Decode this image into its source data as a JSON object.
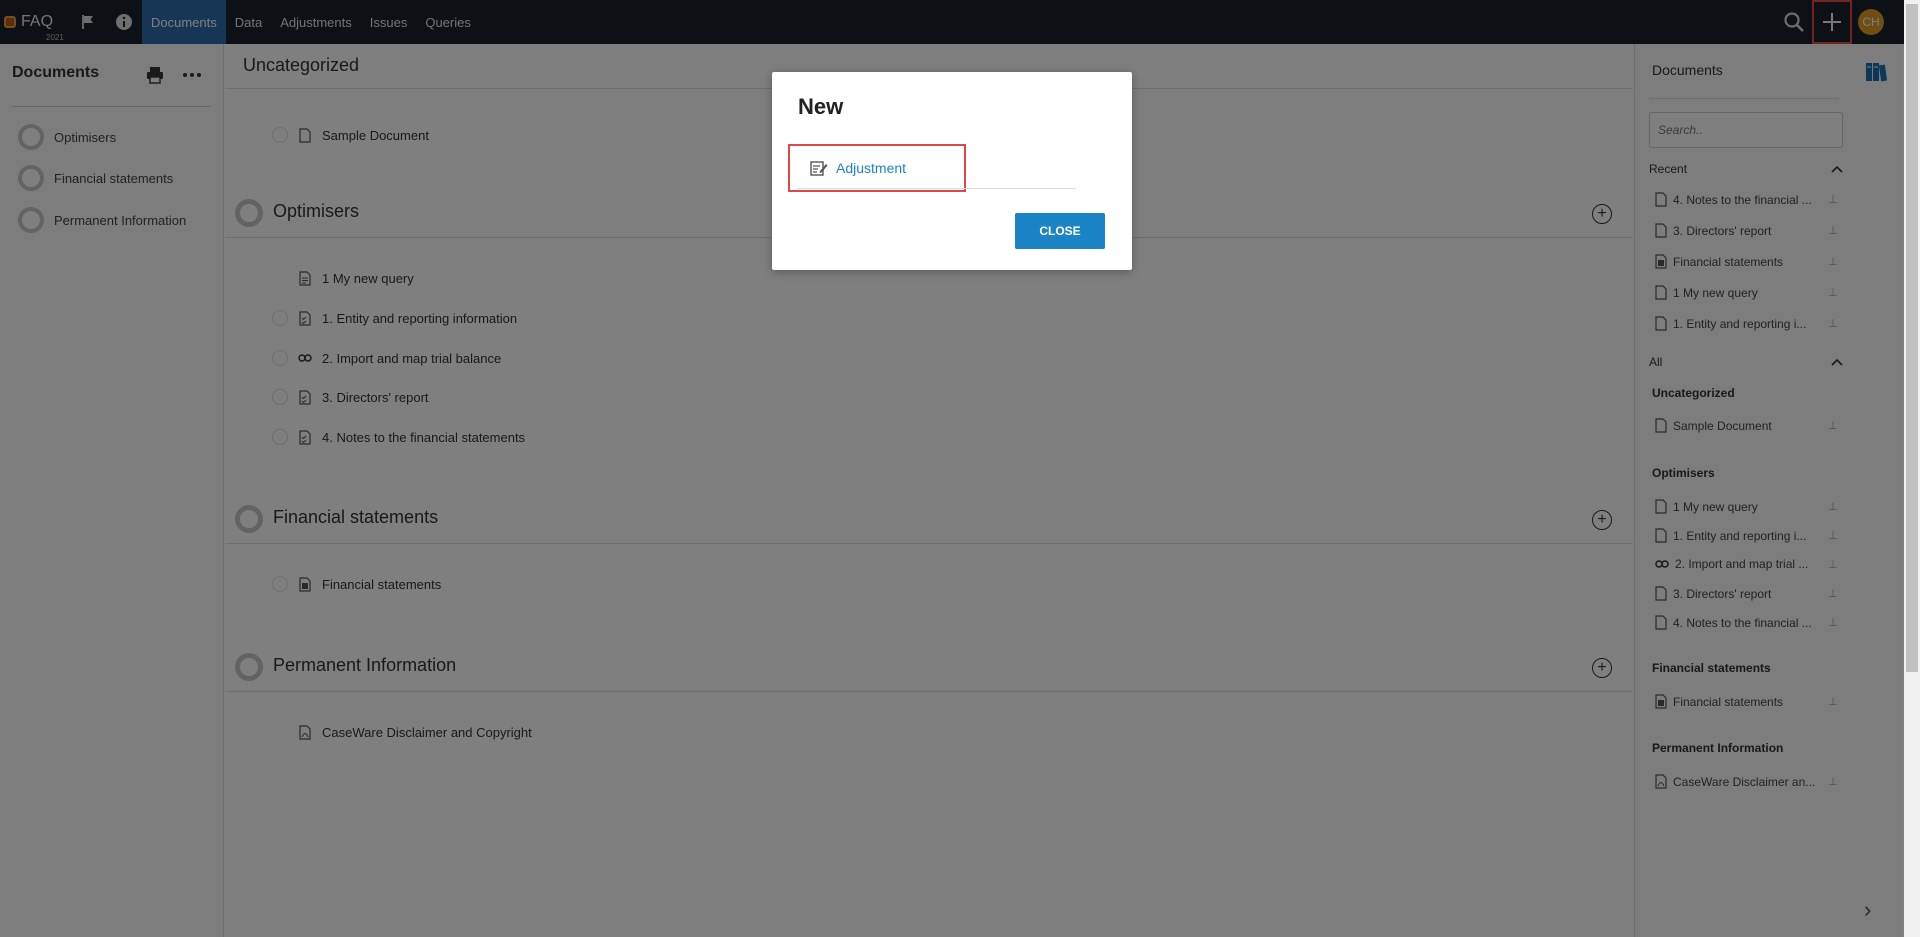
{
  "topbar": {
    "app_name": "FAQ",
    "year": "2021",
    "tabs": [
      {
        "label": "Documents",
        "active": true
      },
      {
        "label": "Data",
        "active": false
      },
      {
        "label": "Adjustments",
        "active": false
      },
      {
        "label": "Issues",
        "active": false
      },
      {
        "label": "Queries",
        "active": false
      }
    ],
    "avatar_initials": "CH",
    "icons": [
      "flag-icon",
      "info-icon",
      "search-icon",
      "plus-icon"
    ]
  },
  "leftbar": {
    "title": "Documents",
    "items": [
      {
        "label": "Optimisers"
      },
      {
        "label": "Financial statements"
      },
      {
        "label": "Permanent Information"
      }
    ]
  },
  "main": {
    "uncategorized": {
      "title": "Uncategorized",
      "docs": [
        {
          "label": "Sample Document",
          "icon": "document-icon"
        }
      ]
    },
    "optimisers": {
      "title": "Optimisers",
      "docs": [
        {
          "label": "1 My new query",
          "icon": "query-doc-icon"
        },
        {
          "label": "1. Entity and reporting information",
          "icon": "checklist-doc-icon"
        },
        {
          "label": "2. Import and map trial balance",
          "icon": "link-icon"
        },
        {
          "label": "3. Directors' report",
          "icon": "checklist-doc-icon"
        },
        {
          "label": "4. Notes to the financial statements",
          "icon": "checklist-doc-icon"
        }
      ]
    },
    "financial": {
      "title": "Financial statements",
      "docs": [
        {
          "label": "Financial statements",
          "icon": "statement-doc-icon"
        }
      ]
    },
    "permanent": {
      "title": "Permanent Information",
      "docs": [
        {
          "label": "CaseWare Disclaimer and Copyright",
          "icon": "pdf-doc-icon"
        }
      ]
    }
  },
  "rightbar": {
    "title": "Documents",
    "search_placeholder": "Search..",
    "recent_label": "Recent",
    "all_label": "All",
    "recent": [
      {
        "label": "4. Notes to the financial ..."
      },
      {
        "label": "3. Directors' report"
      },
      {
        "label": "Financial statements"
      },
      {
        "label": "1 My new query"
      },
      {
        "label": "1. Entity and reporting i..."
      }
    ],
    "groups": {
      "uncategorized": {
        "title": "Uncategorized",
        "items": [
          {
            "label": "Sample Document"
          }
        ]
      },
      "optimisers": {
        "title": "Optimisers",
        "items": [
          {
            "label": "1 My new query"
          },
          {
            "label": "1. Entity and reporting i..."
          },
          {
            "label": "2. Import and map trial ..."
          },
          {
            "label": "3. Directors' report"
          },
          {
            "label": "4. Notes to the financial ..."
          }
        ]
      },
      "financial": {
        "title": "Financial statements",
        "items": [
          {
            "label": "Financial statements"
          }
        ]
      },
      "permanent": {
        "title": "Permanent Information",
        "items": [
          {
            "label": "CaseWare Disclaimer an..."
          }
        ]
      }
    }
  },
  "modal": {
    "title": "New",
    "option_label": "Adjustment",
    "close_label": "CLOSE"
  },
  "colors": {
    "topbar_bg": "#1b2029",
    "active_tab": "#2f6aa8",
    "accent_blue": "#1b84c6",
    "highlight_red": "#e04848",
    "avatar": "#e09a22"
  }
}
